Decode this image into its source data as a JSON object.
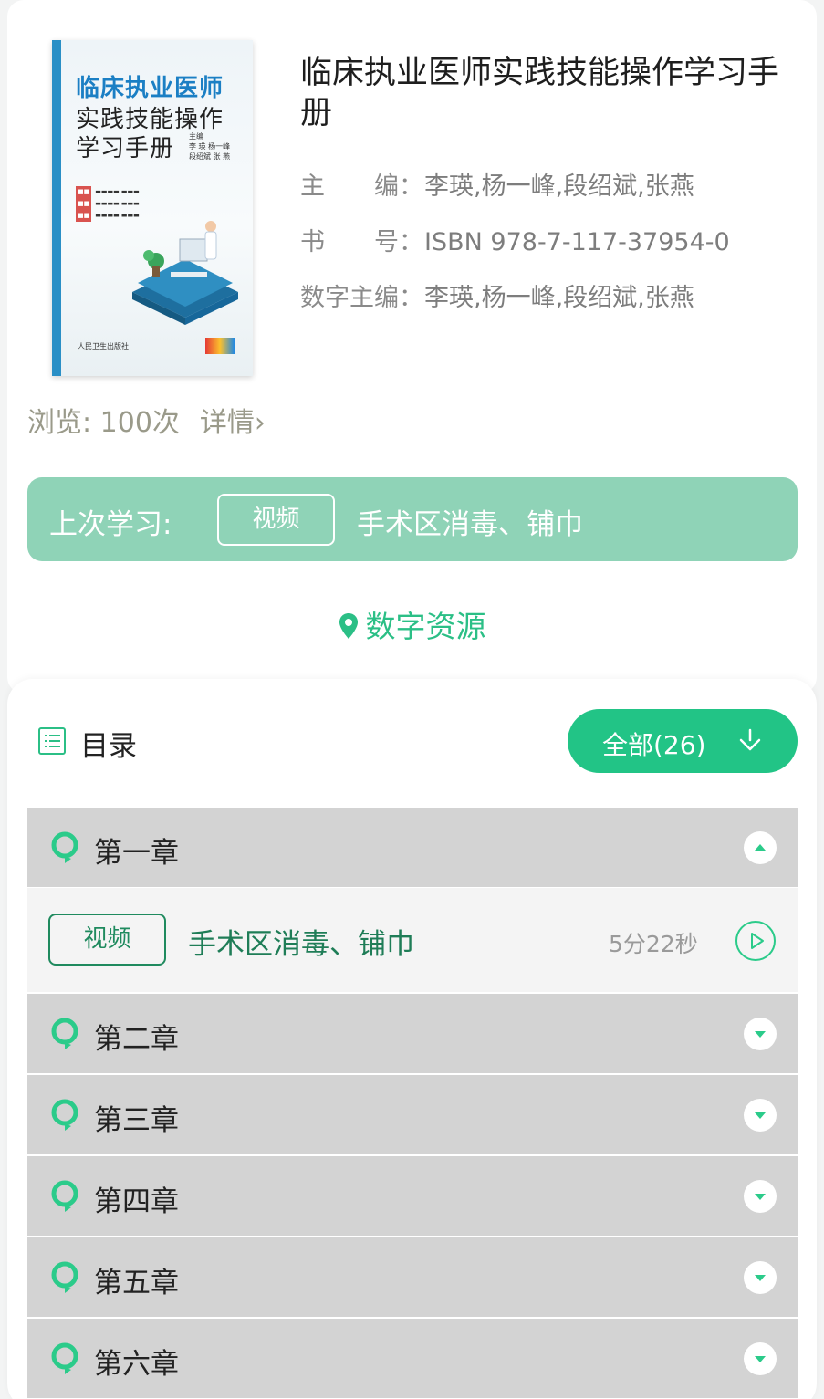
{
  "book": {
    "cover": {
      "title_line1": "临床执业医师",
      "title_line2": "实践技能操作",
      "title_line3": "学习手册",
      "editors_heading": "主编",
      "editors_line1": "李 瑛   杨一峰",
      "editors_line2": "段绍斌   张 燕",
      "publisher": "人民卫生出版社"
    },
    "title": "临床执业医师实践技能操作学习手册",
    "meta": {
      "editor_label": "主　　编：",
      "editor_value": "李瑛,杨一峰,段绍斌,张燕",
      "isbn_label": "书　　号：",
      "isbn_value": "ISBN 978-7-117-37954-0",
      "digital_editor_label": "数字主编：",
      "digital_editor_value": "李瑛,杨一峰,段绍斌,张燕"
    },
    "views": "浏览: 100次",
    "detail_link": "详情›"
  },
  "last_study": {
    "label": "上次学习:",
    "badge": "视频",
    "title": "手术区消毒、铺巾"
  },
  "digital_resources": {
    "label": "数字资源",
    "icon": "location-pin-icon"
  },
  "toc": {
    "label": "目录",
    "filter_label": "全部(26)",
    "filter_icon": "arrow-down-icon",
    "chapters": [
      {
        "title": "第一章",
        "expanded": true
      },
      {
        "title": "第二章",
        "expanded": false
      },
      {
        "title": "第三章",
        "expanded": false
      },
      {
        "title": "第四章",
        "expanded": false
      },
      {
        "title": "第五章",
        "expanded": false
      },
      {
        "title": "第六章",
        "expanded": false
      }
    ],
    "lessons": [
      {
        "badge": "视频",
        "title": "手术区消毒、铺巾",
        "duration": "5分22秒"
      }
    ]
  },
  "colors": {
    "accent": "#22c486",
    "accent_dark": "#1f8a5e",
    "last_study_bg": "#8fd3b7",
    "chapter_bg": "#d3d3d3"
  }
}
